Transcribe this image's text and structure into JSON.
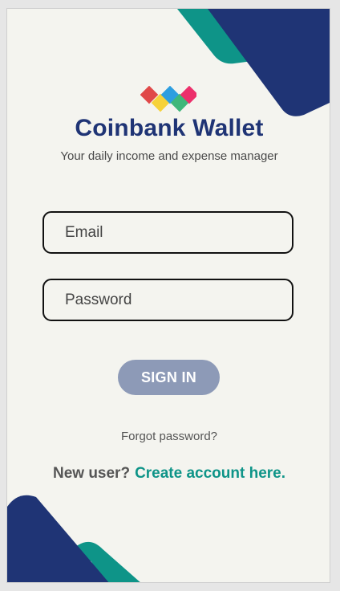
{
  "app": {
    "title": "Coinbank Wallet",
    "tagline": "Your daily income and expense manager"
  },
  "form": {
    "email_placeholder": "Email",
    "password_placeholder": "Password",
    "signin_label": "SIGN IN"
  },
  "links": {
    "forgot_password": "Forgot password?",
    "new_user_label": "New user?",
    "create_account": "Create account here."
  },
  "colors": {
    "brand_navy": "#1f3475",
    "accent_teal": "#0e9488",
    "button_muted": "#8d9ab7",
    "background": "#f4f4ef"
  },
  "icons": {
    "logo": "four-diamond-logo-icon"
  }
}
